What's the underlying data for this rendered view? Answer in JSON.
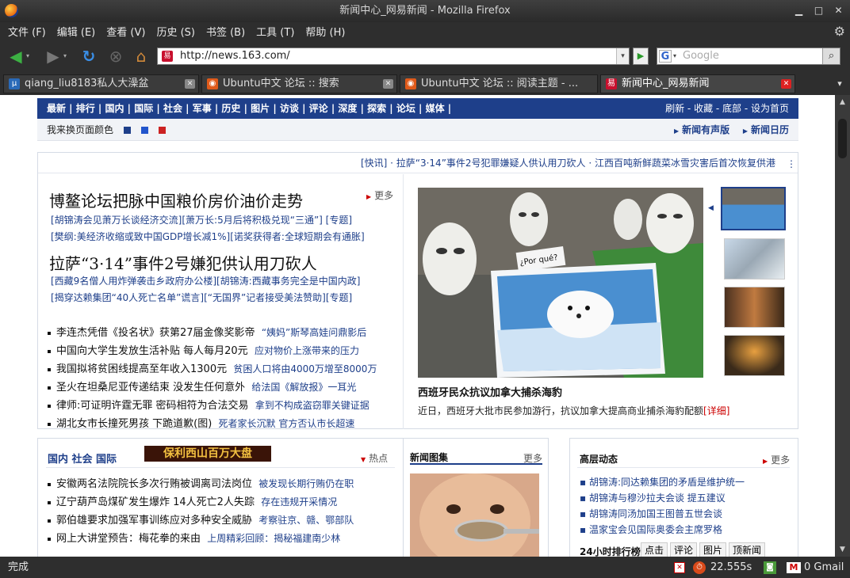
{
  "window": {
    "title": "新闻中心_网易新闻 - Mozilla Firefox"
  },
  "menu": [
    "文件 (F)",
    "编辑 (E)",
    "查看 (V)",
    "历史 (S)",
    "书签 (B)",
    "工具 (T)",
    "帮助 (H)"
  ],
  "url": "http://news.163.com/",
  "search_placeholder": "Google",
  "tabs": [
    {
      "label": "qiang_liu8183私人大澡盆"
    },
    {
      "label": "Ubuntu中文 论坛 :: 搜索"
    },
    {
      "label": "Ubuntu中文 论坛 :: 阅读主题 - ..."
    },
    {
      "label": "新闻中心_网易新闻"
    }
  ],
  "page": {
    "topnav": "最新 | 排行 | 国内 | 国际 | 社会 | 军事 | 历史 | 图片 | 访谈 | 评论 | 深度 | 探索 | 论坛 | 媒体 |",
    "topnav_right": "刷新 - 收藏 - 底部 - 设为首页",
    "color_label": "我来换页面颜色",
    "sublinks": [
      "新闻有声版",
      "新闻日历"
    ],
    "ticker": "[快讯] · 拉萨“3·14”事件2号犯罪嫌疑人供认用刀砍人    · 江西百吨新鲜蔬菜冰雪灾害后首次恢复供港",
    "more": "更多",
    "headline1": "博鳌论坛把脉中国粮价房价油价走势",
    "headline1_links": [
      "[胡锦涛会见萧万长谈经济交流][萧万长:5月后将积极兑现“三通”] [专题]",
      "[樊纲:美经济收缩或致中国GDP增长减1%][诺奖获得者:全球短期会有通胀]"
    ],
    "headline2": "拉萨“3·14”事件2号嫌犯供认用刀砍人",
    "headline2_links": [
      "[西藏9名僧人用炸弹袭击乡政府办公楼][胡锦涛:西藏事务完全是中国内政]",
      "[揭穿达赖集团“40人死亡名单”谎言][“无国界”记者接受美法赞助][专题]"
    ],
    "news_list": [
      {
        "main": "李连杰凭借《投名状》获第27届金像奖影帝",
        "sub": "“姨妈”斯琴高娃问鼎影后"
      },
      {
        "main": "中国向大学生发放生活补贴 每人每月20元",
        "sub": "应对物价上涨带来的压力"
      },
      {
        "main": "我国拟将贫困线提高至年收入1300元",
        "sub": "贫困人口将由4000万增至8000万"
      },
      {
        "main": "圣火在坦桑尼亚传递结束 没发生任何意外",
        "sub": "给法国《解放报》一耳光"
      },
      {
        "main": "律师:可证明许霆无罪 密码相符为合法交易",
        "sub": "拿到不构成盗窃罪关键证据"
      },
      {
        "main": "湖北女市长撞死男孩 下跪道歉(图)",
        "sub": "死者家长沉默  官方否认市长超速"
      }
    ],
    "photo_caption": "西班牙民众抗议加拿大捕杀海豹",
    "photo_desc": "近日，西班牙大批市民参加游行，抗议加拿大提高商业捕杀海豹配额",
    "photo_detail": "[详细]",
    "photo_sign": "¿Por qué?",
    "section_title": "国内 社会 国际",
    "ad_text": "保利西山百万大盘",
    "hot": "热点",
    "section_list": [
      {
        "main": "安徽两名法院院长多次行贿被调离司法岗位",
        "sub": "被发现长期行贿仍在职"
      },
      {
        "main": "辽宁葫芦岛煤矿发生爆炸 14人死亡2人失踪",
        "sub": "存在违规开采情况"
      },
      {
        "main": "郭伯雄要求加强军事训练应对多种安全威胁",
        "sub": "考察驻京、赣、鄂部队"
      },
      {
        "main": "网上大讲堂预告：梅花拳的来由",
        "sub": "上周精彩回顾：揭秘福建南少林"
      }
    ],
    "gallery_title": "新闻图集",
    "senior_title": "高层动态",
    "senior_list": [
      "胡锦涛:同达赖集团的矛盾是维护统一",
      "胡锦涛与穆沙拉夫会谈 提五建议",
      "胡锦涛同汤加国王图普五世会谈",
      "温家宝会见国际奥委会主席罗格"
    ],
    "rank_title": "24小时排行榜",
    "rank_tabs": [
      "点击",
      "评论",
      "图片",
      "顶新闻"
    ]
  },
  "status": {
    "text": "完成",
    "timer": "22.555s",
    "gmail": "0 Gmail"
  },
  "colors": {
    "accent": "#1e3f8a",
    "swatches": [
      "#1e3f8a",
      "#2255cc",
      "#cc2222"
    ]
  }
}
